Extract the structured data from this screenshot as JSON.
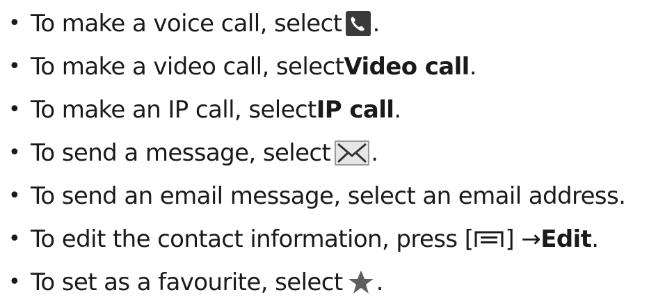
{
  "bullet": "•",
  "items": [
    {
      "text_before": "To make a voice call, select ",
      "icon": "phone-icon",
      "text_after": "."
    },
    {
      "text_before": "To make a video call, select ",
      "bold": "Video call",
      "text_after": "."
    },
    {
      "text_before": "To make an IP call, select ",
      "bold": "IP call",
      "text_after": "."
    },
    {
      "text_before": "To send a message, select ",
      "icon": "envelope-icon",
      "text_after": "."
    },
    {
      "text_before": "To send an email message, select an email address."
    },
    {
      "text_before": "To edit the contact information, press [",
      "icon": "menu-key-icon",
      "text_mid": "] → ",
      "bold": "Edit",
      "text_after": "."
    },
    {
      "text_before": "To set as a favourite, select ",
      "icon": "star-icon",
      "text_after": "."
    }
  ],
  "colors": {
    "text": "#1a1a1a",
    "icon_bg": "#3a3a3a",
    "icon_fg": "#ffffff"
  }
}
